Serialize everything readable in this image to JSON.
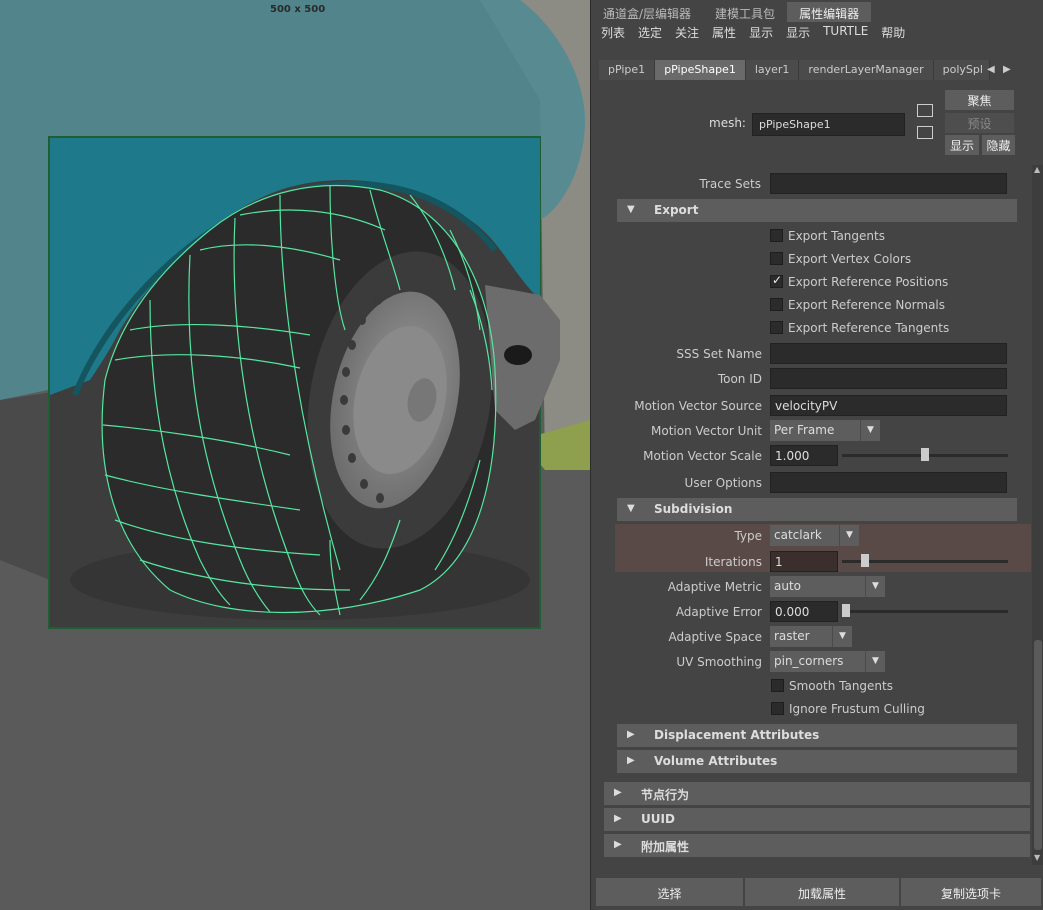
{
  "viewport": {
    "resolution_label": "500 x 500"
  },
  "tabs": [
    "通道盒/层编辑器",
    "建模工具包",
    "属性编辑器"
  ],
  "active_tab": 2,
  "menu": [
    "列表",
    "选定",
    "关注",
    "属性",
    "显示",
    "显示",
    "TURTLE",
    "帮助"
  ],
  "node_tabs": [
    "pPipe1",
    "pPipeShape1",
    "layer1",
    "renderLayerManager",
    "polySpl"
  ],
  "active_node_tab": 1,
  "mesh": {
    "label": "mesh:",
    "value": "pPipeShape1",
    "focus_button": "聚焦",
    "preset_button": "预设",
    "show_button": "显示",
    "hide_button": "隐藏"
  },
  "attributes": {
    "trace_sets_label": "Trace Sets",
    "trace_sets_value": "",
    "export": {
      "title": "Export",
      "checkboxes": [
        {
          "label": "Export Tangents",
          "checked": false
        },
        {
          "label": "Export Vertex Colors",
          "checked": false
        },
        {
          "label": "Export Reference Positions",
          "checked": true
        },
        {
          "label": "Export Reference Normals",
          "checked": false
        },
        {
          "label": "Export Reference Tangents",
          "checked": false
        }
      ]
    },
    "sss_set_name_label": "SSS Set Name",
    "sss_set_name_value": "",
    "toon_id_label": "Toon ID",
    "toon_id_value": "",
    "motion_vector_source_label": "Motion Vector Source",
    "motion_vector_source_value": "velocityPV",
    "motion_vector_unit_label": "Motion Vector Unit",
    "motion_vector_unit_value": "Per Frame",
    "motion_vector_scale_label": "Motion Vector Scale",
    "motion_vector_scale_value": "1.000",
    "motion_vector_scale_slider": 0.5,
    "user_options_label": "User Options",
    "user_options_value": "",
    "subdivision": {
      "title": "Subdivision",
      "type_label": "Type",
      "type_value": "catclark",
      "iterations_label": "Iterations",
      "iterations_value": "1",
      "iterations_slider": 0.12,
      "adaptive_metric_label": "Adaptive Metric",
      "adaptive_metric_value": "auto",
      "adaptive_error_label": "Adaptive Error",
      "adaptive_error_value": "0.000",
      "adaptive_error_slider": 0.0,
      "adaptive_space_label": "Adaptive Space",
      "adaptive_space_value": "raster",
      "uv_smoothing_label": "UV Smoothing",
      "uv_smoothing_value": "pin_corners",
      "smooth_tangents_label": "Smooth Tangents",
      "smooth_tangents_checked": false,
      "ignore_frustum_culling_label": "Ignore Frustum Culling",
      "ignore_frustum_culling_checked": false
    },
    "displacement_title": "Displacement Attributes",
    "volume_title": "Volume Attributes",
    "node_behavior_title": "节点行为",
    "uuid_title": "UUID",
    "extra_attributes_title": "附加属性"
  },
  "bottom_buttons": [
    "选择",
    "加载属性",
    "复制选项卡"
  ],
  "colors": {
    "wireframe": "#55e6a0",
    "highlight": "#5a4a47",
    "car_body": "#2d7f8a"
  }
}
